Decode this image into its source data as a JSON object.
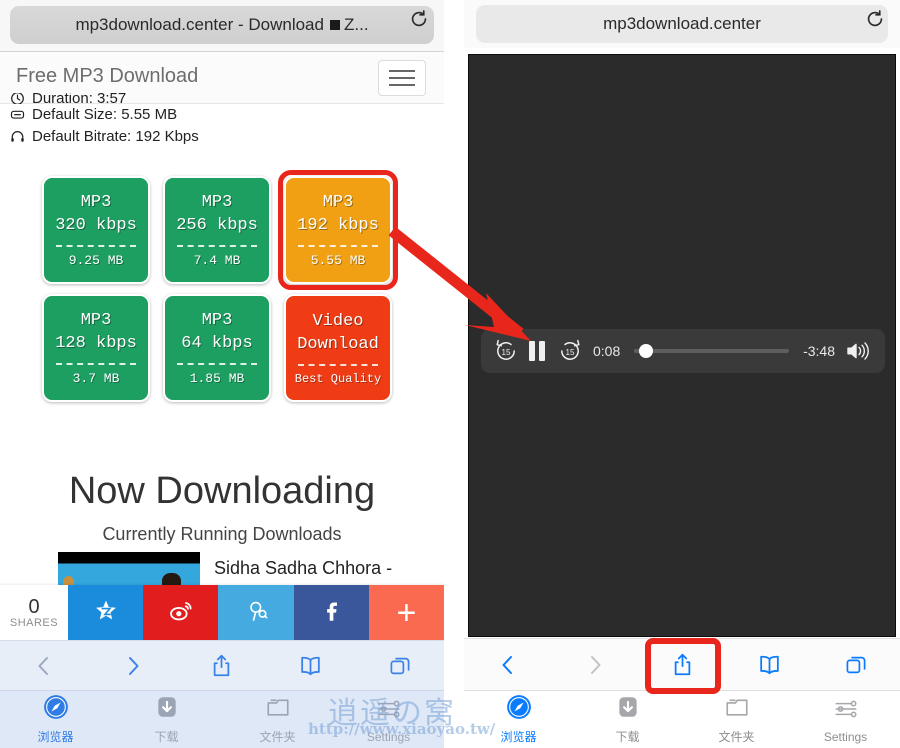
{
  "left_panel": {
    "urlbar": {
      "title": "mp3download.center - Download",
      "suffix": "Z...",
      "reload_icon": "reload-icon"
    },
    "site_header": {
      "title": "Free MP3 Download",
      "menu_icon": "hamburger-menu-icon"
    },
    "meta": [
      {
        "icon": "clock-icon",
        "text": "Duration: 3:57"
      },
      {
        "icon": "disk-icon",
        "text": "Default Size: 5.55 MB"
      },
      {
        "icon": "headphones-icon",
        "text": "Default Bitrate: 192 Kbps"
      }
    ],
    "download_buttons": [
      {
        "format": "MP3",
        "rate": "320 kbps",
        "size": "9.25 MB",
        "color": "#1d9f62",
        "style": "green",
        "highlighted": false
      },
      {
        "format": "MP3",
        "rate": "256 kbps",
        "size": "7.4 MB",
        "color": "#1d9f62",
        "style": "green",
        "highlighted": false
      },
      {
        "format": "MP3",
        "rate": "192 kbps",
        "size": "5.55 MB",
        "color": "#f0a012",
        "style": "orange",
        "highlighted": true
      },
      {
        "format": "MP3",
        "rate": "128 kbps",
        "size": "3.7 MB",
        "color": "#1d9f62",
        "style": "green",
        "highlighted": false
      },
      {
        "format": "MP3",
        "rate": "64 kbps",
        "size": "1.85 MB",
        "color": "#1d9f62",
        "style": "green",
        "highlighted": false
      },
      {
        "format": "Video",
        "rate": "Download",
        "size": "Best Quality",
        "color": "#ef3c14",
        "style": "red",
        "highlighted": false
      }
    ],
    "now_downloading": {
      "title": "Now Downloading",
      "subtitle": "Currently Running Downloads",
      "item_name": "Sidha Sadha Chhora - "
    },
    "share_bar": {
      "count": "0",
      "count_label": "SHARES",
      "buttons": [
        {
          "name": "qzone",
          "color": "#1a8cdb"
        },
        {
          "name": "weibo",
          "color": "#e21d1d"
        },
        {
          "name": "pinterest",
          "color": "#44aae0"
        },
        {
          "name": "facebook",
          "color": "#39579a"
        },
        {
          "name": "more",
          "color": "#fa6a50",
          "glyph": "+"
        }
      ]
    },
    "safari_nav": [
      {
        "icon": "back-chevron-icon",
        "enabled": false
      },
      {
        "icon": "forward-chevron-icon",
        "enabled": true
      },
      {
        "icon": "share-icon",
        "enabled": true
      },
      {
        "icon": "bookmarks-icon",
        "enabled": true
      },
      {
        "icon": "tabs-icon",
        "enabled": true
      }
    ],
    "app_tabs": [
      {
        "label": "浏览器",
        "icon": "safari-compass-icon",
        "active": true
      },
      {
        "label": "下载",
        "icon": "download-icon",
        "active": false
      },
      {
        "label": "文件夹",
        "icon": "folder-icon",
        "active": false
      },
      {
        "label": "Settings",
        "icon": "sliders-icon",
        "active": false
      }
    ]
  },
  "right_panel": {
    "urlbar": {
      "title": "mp3download.center",
      "reload_icon": "reload-icon"
    },
    "player": {
      "skip_back_label": "15",
      "skip_forward_label": "15",
      "state_icon": "pause-icon",
      "elapsed": "0:08",
      "remaining": "-3:48",
      "progress_percent": 3,
      "volume_icon": "volume-high-icon"
    },
    "safari_nav": [
      {
        "icon": "back-chevron-icon",
        "enabled": true
      },
      {
        "icon": "forward-chevron-icon",
        "enabled": false
      },
      {
        "icon": "share-icon",
        "enabled": true,
        "highlighted": true
      },
      {
        "icon": "bookmarks-icon",
        "enabled": true
      },
      {
        "icon": "tabs-icon",
        "enabled": true
      }
    ],
    "app_tabs": [
      {
        "label": "浏览器",
        "icon": "safari-compass-icon",
        "active": true
      },
      {
        "label": "下载",
        "icon": "download-icon",
        "active": false
      },
      {
        "label": "文件夹",
        "icon": "folder-icon",
        "active": false
      },
      {
        "label": "Settings",
        "icon": "sliders-icon",
        "active": false
      }
    ]
  },
  "annotation": {
    "arrow_color": "#e8261c",
    "highlight_color": "#e8261c"
  },
  "watermark": {
    "cjk": "逍遥の窝",
    "url": "http://www.xiaoyao.tw/"
  }
}
